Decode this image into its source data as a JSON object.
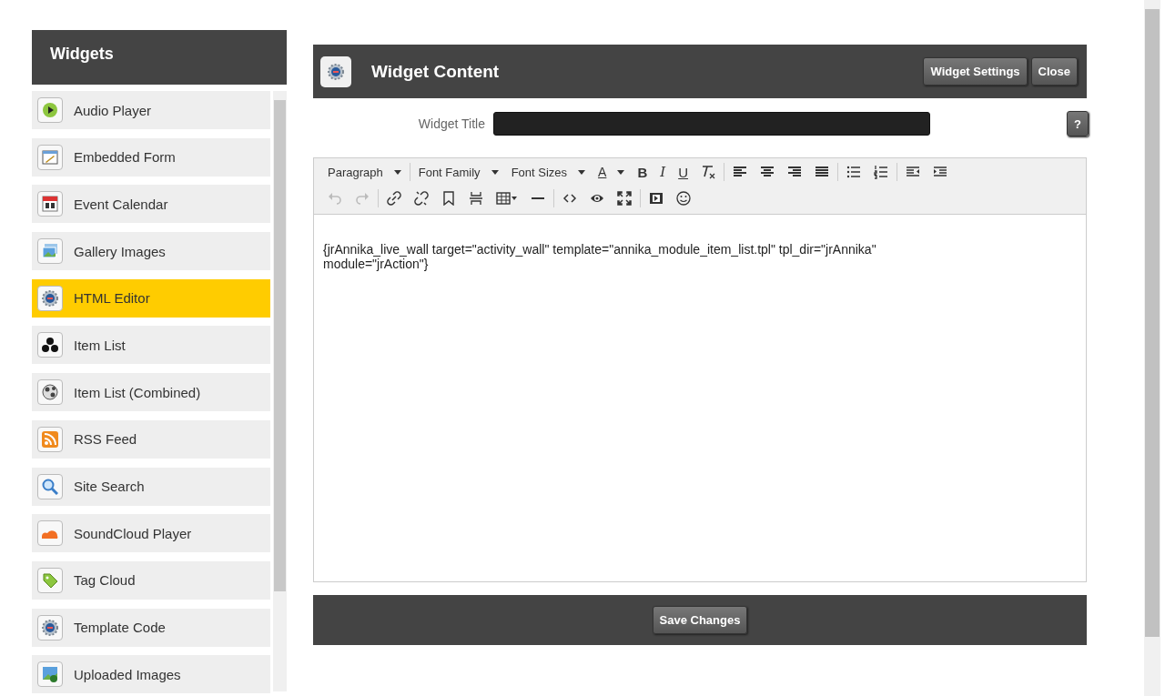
{
  "sidebar": {
    "title": "Widgets",
    "items": [
      {
        "label": "Audio Player",
        "kind": "play",
        "selected": false
      },
      {
        "label": "Embedded Form",
        "kind": "form",
        "selected": false
      },
      {
        "label": "Event Calendar",
        "kind": "calendar",
        "selected": false
      },
      {
        "label": "Gallery Images",
        "kind": "gallery",
        "selected": false
      },
      {
        "label": "HTML Editor",
        "kind": "gear",
        "selected": true
      },
      {
        "label": "Item List",
        "kind": "trefoil",
        "selected": false
      },
      {
        "label": "Item List (Combined)",
        "kind": "ball",
        "selected": false
      },
      {
        "label": "RSS Feed",
        "kind": "rss",
        "selected": false
      },
      {
        "label": "Site Search",
        "kind": "search",
        "selected": false
      },
      {
        "label": "SoundCloud Player",
        "kind": "cloud",
        "selected": false
      },
      {
        "label": "Tag Cloud",
        "kind": "tag",
        "selected": false
      },
      {
        "label": "Template Code",
        "kind": "gear",
        "selected": false
      },
      {
        "label": "Uploaded Images",
        "kind": "upload",
        "selected": false
      }
    ]
  },
  "panel": {
    "title": "Widget Content",
    "buttons": [
      "Widget Settings",
      "Close"
    ],
    "field": {
      "label": "Widget Title",
      "help": "?"
    },
    "toolbar": [
      [
        {
          "kind": "dropdown",
          "label": "Paragraph"
        },
        {
          "kind": "separator"
        },
        {
          "kind": "dropdown",
          "label": "Font Family"
        },
        {
          "kind": "dropdown",
          "label": "Font Sizes"
        },
        {
          "kind": "color",
          "label": "A"
        },
        {
          "kind": "bold",
          "label": "B"
        },
        {
          "kind": "italic",
          "label": "I"
        },
        {
          "kind": "underline",
          "label": "U"
        },
        {
          "kind": "clear"
        },
        {
          "kind": "separator"
        },
        {
          "kind": "alignleft"
        },
        {
          "kind": "aligncenter"
        },
        {
          "kind": "alignright"
        },
        {
          "kind": "justify"
        },
        {
          "kind": "separator"
        },
        {
          "kind": "bullets"
        },
        {
          "kind": "numbers"
        },
        {
          "kind": "separator"
        },
        {
          "kind": "outdent"
        },
        {
          "kind": "indent"
        }
      ],
      [
        {
          "kind": "undo",
          "disabled": true
        },
        {
          "kind": "redo",
          "disabled": true
        },
        {
          "kind": "separator"
        },
        {
          "kind": "link"
        },
        {
          "kind": "unlink"
        },
        {
          "kind": "bookmark"
        },
        {
          "kind": "pagebreak"
        },
        {
          "kind": "table"
        },
        {
          "kind": "rule"
        },
        {
          "kind": "separator"
        },
        {
          "kind": "code"
        },
        {
          "kind": "preview"
        },
        {
          "kind": "fullscreen"
        },
        {
          "kind": "separator"
        },
        {
          "kind": "media"
        },
        {
          "kind": "emoticon"
        }
      ]
    ],
    "content": "{jrAnnika_live_wall target=\"activity_wall\" template=\"annika_module_item_list.tpl\" tpl_dir=\"jrAnnika\" module=\"jrAction\"}",
    "save": "Save Changes"
  }
}
